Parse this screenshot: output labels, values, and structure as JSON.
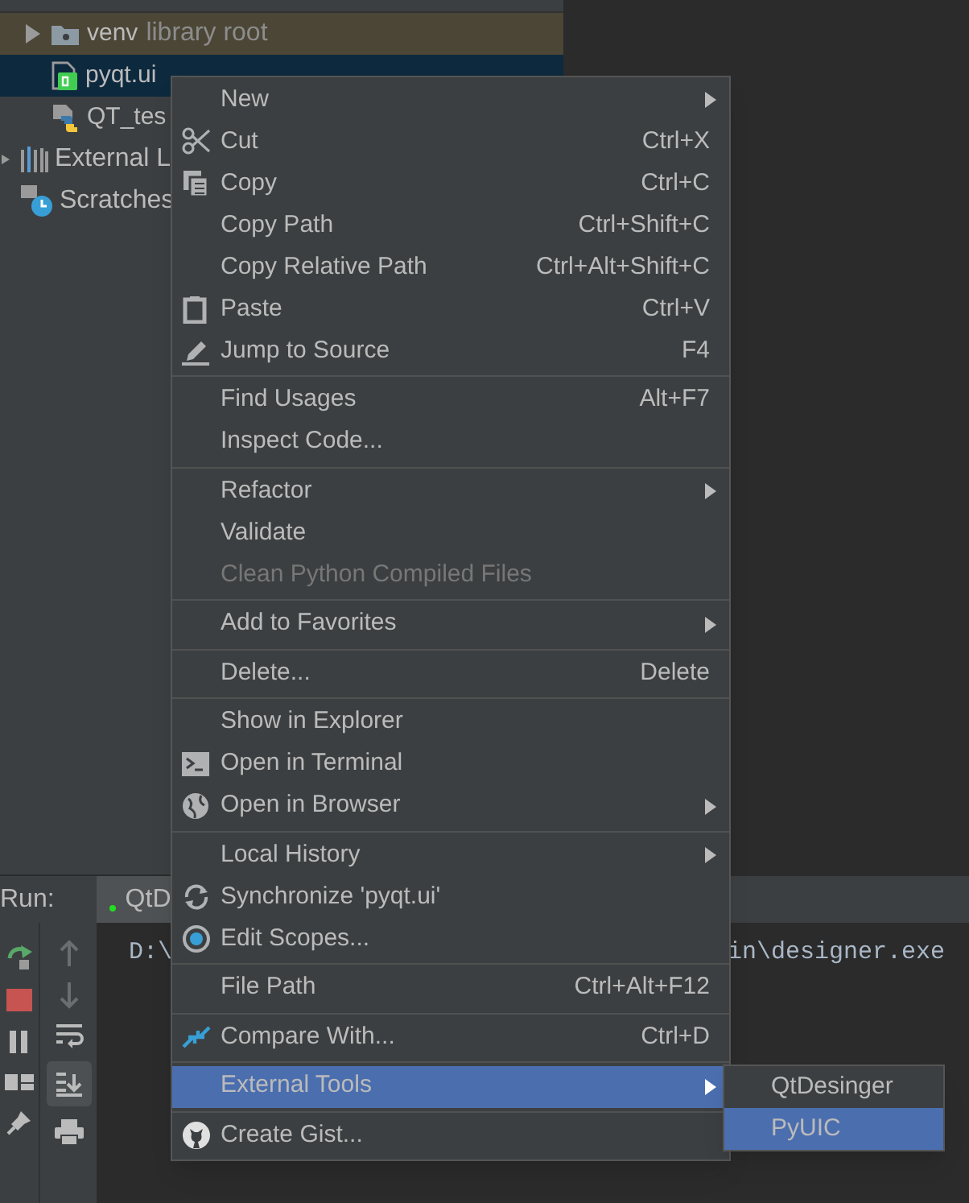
{
  "project": {
    "children": [
      {
        "label": "venv",
        "secondary": "library root",
        "expanded": false,
        "highlighted": true,
        "selected": false
      },
      {
        "label": "pyqt.ui",
        "selected": true
      },
      {
        "label": "QT_tes",
        "selected": false
      }
    ]
  },
  "tree": {
    "items": [
      {
        "label": "External L",
        "expanded": false,
        "selected": false
      },
      {
        "label": "Scratches",
        "selected": false
      }
    ]
  },
  "run_panel": {
    "title": "Run:",
    "tabs": [
      {
        "label": "QtD",
        "running": true,
        "selected": true
      }
    ],
    "console": {
      "start": "D:\\",
      "end": "in\\designer.exe"
    }
  },
  "context_menu": {
    "groups": [
      [
        {
          "label": "New",
          "submenu": true,
          "disabled": false,
          "selected": false
        },
        {
          "label": "Cut",
          "shortcut": "Ctrl+X",
          "disabled": false,
          "selected": false
        },
        {
          "label": "Copy",
          "shortcut": "Ctrl+C",
          "disabled": false,
          "selected": false
        },
        {
          "label": "Copy Path",
          "shortcut": "Ctrl+Shift+C",
          "disabled": false,
          "selected": false
        },
        {
          "label": "Copy Relative Path",
          "shortcut": "Ctrl+Alt+Shift+C",
          "disabled": false,
          "selected": false
        },
        {
          "label": "Paste",
          "shortcut": "Ctrl+V",
          "disabled": false,
          "selected": false
        },
        {
          "label": "Jump to Source",
          "shortcut": "F4",
          "disabled": false,
          "selected": false
        }
      ],
      [
        {
          "label": "Find Usages",
          "shortcut": "Alt+F7",
          "disabled": false,
          "selected": false
        },
        {
          "label": "Inspect Code...",
          "disabled": false,
          "selected": false
        }
      ],
      [
        {
          "label": "Refactor",
          "submenu": true,
          "disabled": false,
          "selected": false
        },
        {
          "label": "Validate",
          "disabled": false,
          "selected": false
        },
        {
          "label": "Clean Python Compiled Files",
          "disabled": true,
          "selected": false
        }
      ],
      [
        {
          "label": "Add to Favorites",
          "submenu": true,
          "disabled": false,
          "selected": false
        }
      ],
      [
        {
          "label": "Delete...",
          "shortcut": "Delete",
          "disabled": false,
          "selected": false
        }
      ],
      [
        {
          "label": "Show in Explorer",
          "disabled": false,
          "selected": false
        },
        {
          "label": "Open in Terminal",
          "disabled": false,
          "selected": false
        },
        {
          "label": "Open in Browser",
          "submenu": true,
          "disabled": false,
          "selected": false
        }
      ],
      [
        {
          "label": "Local History",
          "submenu": true,
          "disabled": false,
          "selected": false
        },
        {
          "label": "Synchronize 'pyqt.ui'",
          "disabled": false,
          "selected": false
        },
        {
          "label": "Edit Scopes...",
          "disabled": false,
          "selected": false
        }
      ],
      [
        {
          "label": "File Path",
          "shortcut": "Ctrl+Alt+F12",
          "disabled": false,
          "selected": false
        }
      ],
      [
        {
          "label": "Compare With...",
          "shortcut": "Ctrl+D",
          "disabled": false,
          "selected": false
        }
      ],
      [
        {
          "label": "External Tools",
          "submenu": true,
          "disabled": false,
          "selected": true
        }
      ],
      [
        {
          "label": "Create Gist...",
          "disabled": false,
          "selected": false
        }
      ]
    ]
  },
  "submenu": {
    "items": [
      {
        "label": "QtDesinger",
        "selected": false
      },
      {
        "label": "PyUIC",
        "selected": true
      }
    ]
  }
}
